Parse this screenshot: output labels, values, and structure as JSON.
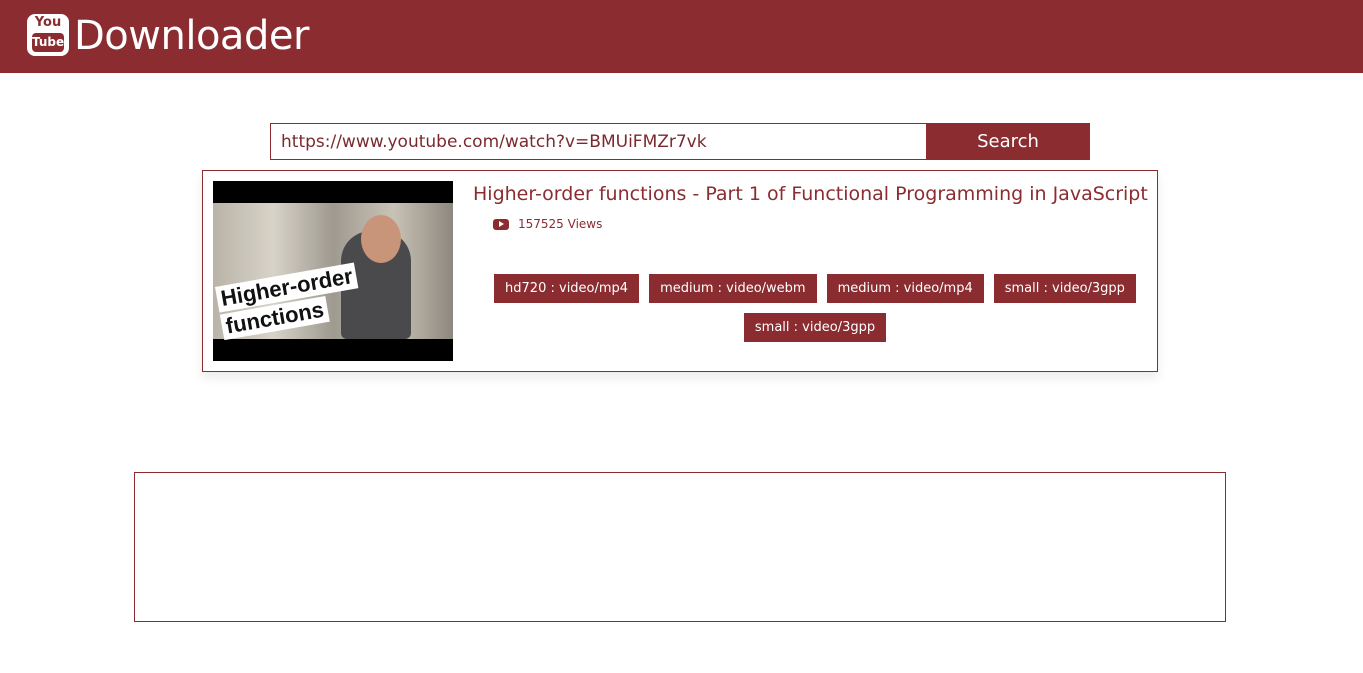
{
  "header": {
    "logo_top": "You",
    "logo_bottom": "Tube",
    "brand": "Downloader"
  },
  "search": {
    "value": "https://www.youtube.com/watch?v=BMUiFMZr7vk",
    "button_label": "Search"
  },
  "video": {
    "thumbnail_caption": [
      "Higher-order",
      "functions"
    ],
    "title": "Higher-order functions - Part 1 of Functional Programming in JavaScript",
    "views_icon": "youtube-play-icon",
    "views": "157525 Views"
  },
  "formats": [
    {
      "label": "hd720 : video/mp4"
    },
    {
      "label": "medium : video/webm"
    },
    {
      "label": "medium : video/mp4"
    },
    {
      "label": "small : video/3gpp"
    },
    {
      "label": "small : video/3gpp"
    }
  ],
  "colors": {
    "brand": "#8a2c30",
    "background": "#ffffff"
  }
}
